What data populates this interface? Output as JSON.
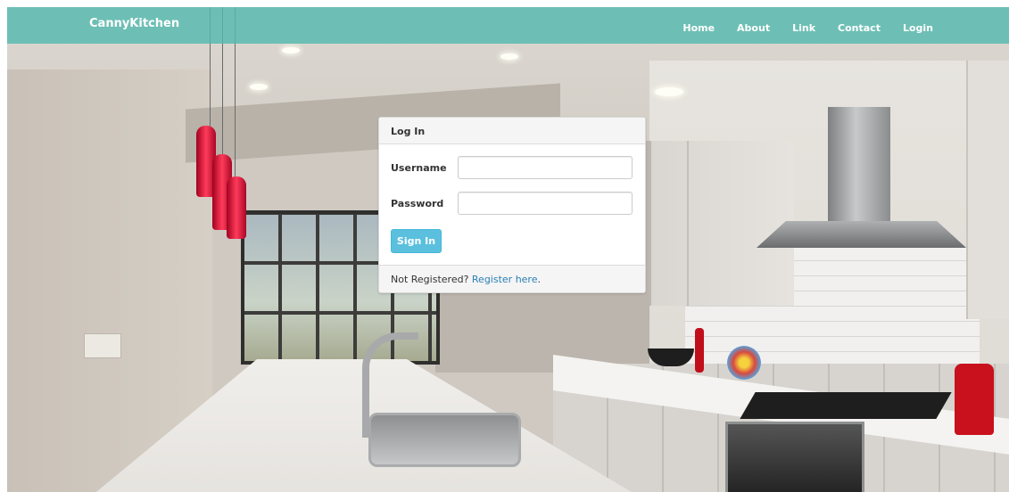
{
  "navbar": {
    "brand": "CannyKitchen",
    "links": [
      "Home",
      "About",
      "Link",
      "Contact",
      "Login"
    ],
    "background": "#54baae"
  },
  "login_panel": {
    "title": "Log In",
    "username_label": "Username",
    "username_value": "",
    "password_label": "Password",
    "password_value": "",
    "submit_label": "Sign In",
    "submit_color": "#5bc0de",
    "footer_text": "Not Registered?",
    "register_link": "Register here",
    "footer_period": "."
  }
}
